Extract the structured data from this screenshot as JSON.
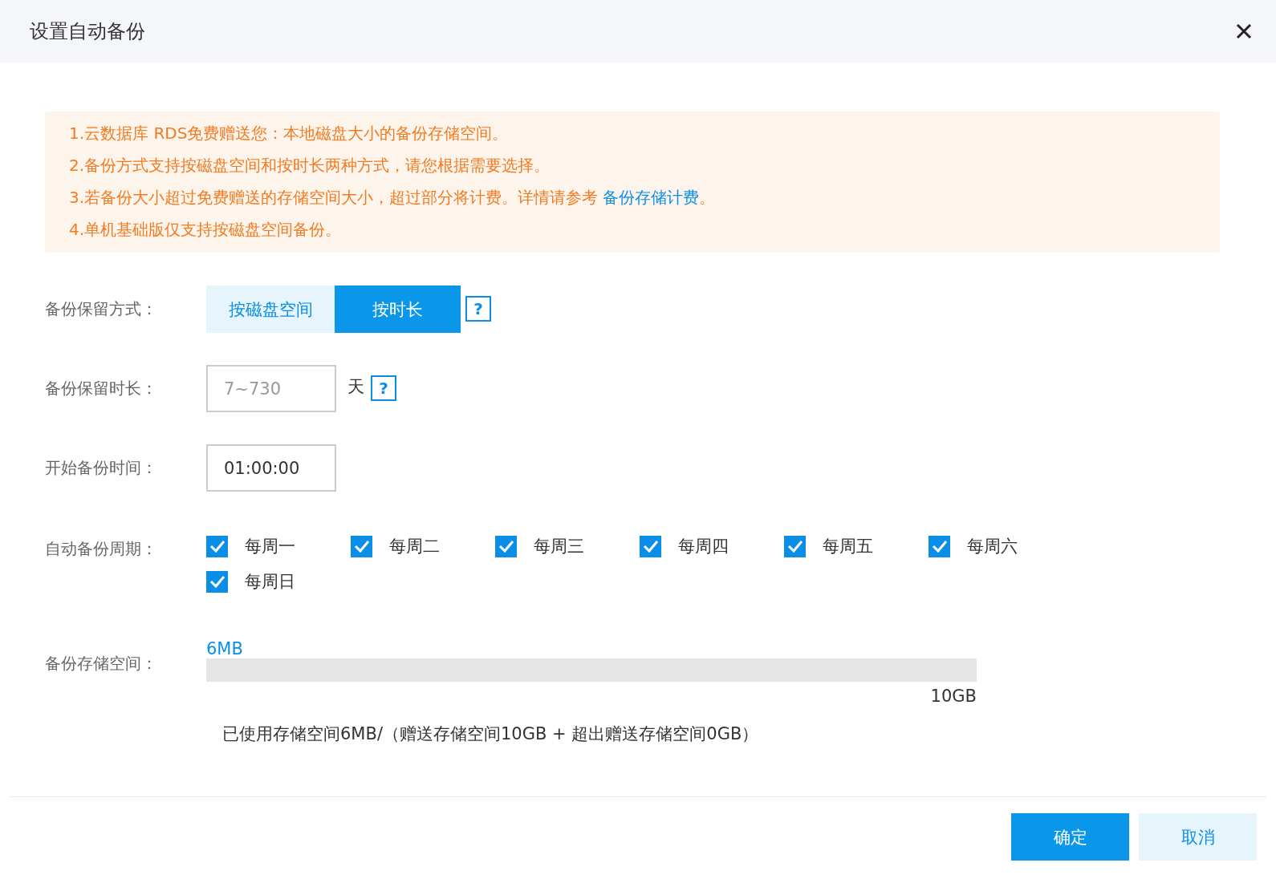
{
  "dialog": {
    "title": "设置自动备份"
  },
  "notice": {
    "lines": [
      {
        "text": "1.云数据库 RDS免费赠送您：本地磁盘大小的备份存储空间。"
      },
      {
        "text": "2.备份方式支持按磁盘空间和按时长两种方式，请您根据需要选择。"
      },
      {
        "text": "3.若备份大小超过免费赠送的存储空间大小，超过部分将计费。详情请参考 ",
        "link": "备份存储计费",
        "suffix": "。"
      },
      {
        "text": "4.单机基础版仅支持按磁盘空间备份。"
      }
    ]
  },
  "retention_mode": {
    "label": "备份保留方式：",
    "options": [
      {
        "label": "按磁盘空间",
        "selected": false
      },
      {
        "label": "按时长",
        "selected": true
      }
    ],
    "help": "?"
  },
  "retention_days": {
    "label": "备份保留时长：",
    "placeholder": "7~730",
    "unit": "天",
    "help": "?"
  },
  "start_time": {
    "label": "开始备份时间：",
    "value": "01:00:00"
  },
  "cycle": {
    "label": "自动备份周期：",
    "days": [
      {
        "label": "每周一",
        "checked": true
      },
      {
        "label": "每周二",
        "checked": true
      },
      {
        "label": "每周三",
        "checked": true
      },
      {
        "label": "每周四",
        "checked": true
      },
      {
        "label": "每周五",
        "checked": true
      },
      {
        "label": "每周六",
        "checked": true
      },
      {
        "label": "每周日",
        "checked": true
      }
    ]
  },
  "storage": {
    "label": "备份存储空间：",
    "used_label": "6MB",
    "max_label": "10GB",
    "summary": "已使用存储空间6MB/（赠送存储空间10GB + 超出赠送存储空间0GB）"
  },
  "buttons": [
    {
      "label": "确定",
      "kind": "primary"
    },
    {
      "label": "取消",
      "kind": "secondary"
    }
  ]
}
